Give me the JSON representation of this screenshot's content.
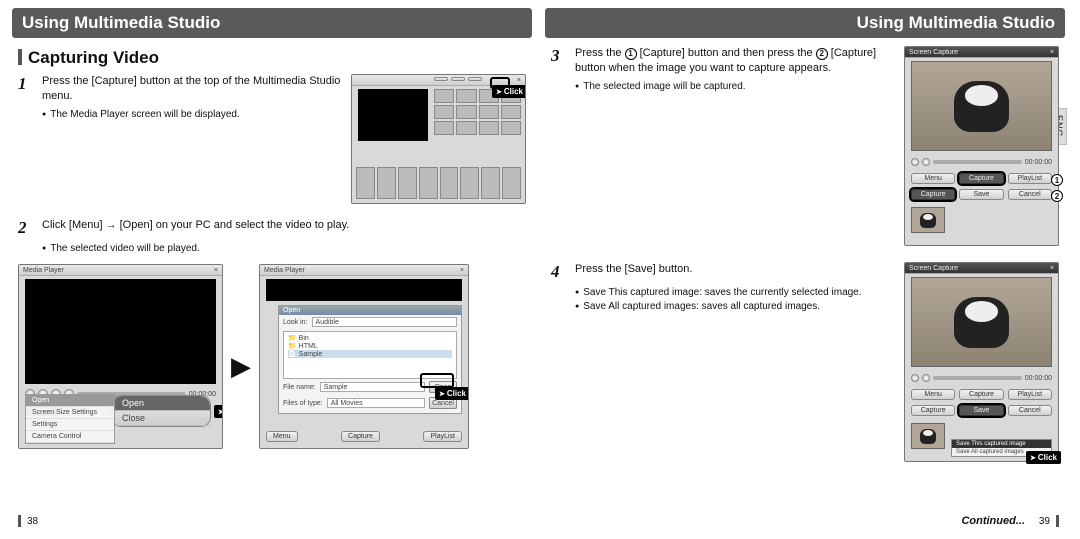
{
  "header": {
    "left_title": "Using Multimedia Studio",
    "right_title": "Using Multimedia Studio"
  },
  "section": {
    "title": "Capturing Video"
  },
  "steps": {
    "s1": {
      "num": "1",
      "text": "Press the [Capture] button at the top of the Multimedia Studio menu.",
      "bullet": "The Media Player screen will be displayed."
    },
    "s2": {
      "num": "2",
      "text": "Click [Menu] → [Open] on your PC and select the video to play.",
      "bullet": "The selected video will be played."
    },
    "s3": {
      "num": "3",
      "text_a": "Press the ",
      "text_b": " [Capture] button and then press the ",
      "text_c": " [Capture] button when the image you want to capture appears.",
      "bullet": "The selected image will be captured."
    },
    "s4": {
      "num": "4",
      "text": "Press the [Save] button.",
      "bullet1": "Save This captured image: saves the currently selected image.",
      "bullet2": "Save All captured images: saves all captured images."
    }
  },
  "screens": {
    "click": "Click",
    "media_player_title": "Media Player",
    "screen_capture_title": "Screen Capture",
    "time": "00:00:00",
    "menu": "Menu",
    "capture": "Capture",
    "playlist": "PlayList",
    "open": "Open",
    "close": "Close",
    "cancel": "Cancel",
    "save": "Save",
    "look_in": "Look in:",
    "audible": "Audible",
    "file_name": "File name:",
    "files_of_type": "Files of type:",
    "all_movies": "All Movies",
    "sample": "Sample",
    "bin": "Bin",
    "html": "HTML",
    "recent_settings": "Screen Size Settings",
    "camera_control": "Camera Control",
    "settings": "Settings",
    "save_this": "Save This captured image",
    "save_all": "Save All captured images"
  },
  "circled": {
    "one": "1",
    "two": "2"
  },
  "lang": "ENG",
  "continued": "Continued...",
  "pages": {
    "left": "38",
    "right": "39"
  }
}
